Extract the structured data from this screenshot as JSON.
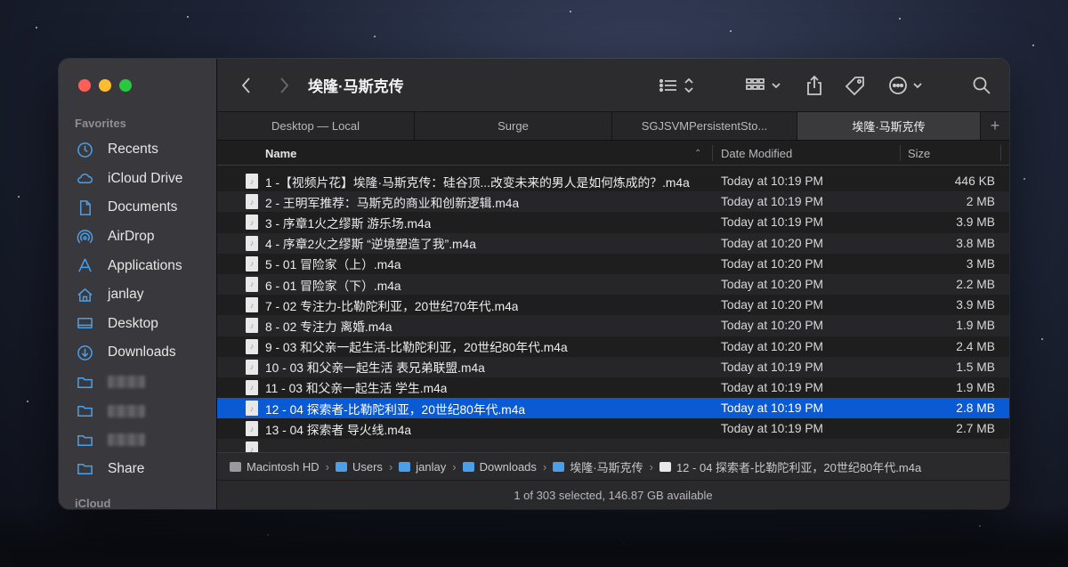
{
  "window": {
    "title": "埃隆·马斯克传"
  },
  "sidebar": {
    "favorites_label": "Favorites",
    "icloud_label": "iCloud",
    "items": [
      {
        "label": "Recents",
        "icon": "clock-icon"
      },
      {
        "label": "iCloud Drive",
        "icon": "cloud-icon"
      },
      {
        "label": "Documents",
        "icon": "document-icon"
      },
      {
        "label": "AirDrop",
        "icon": "airdrop-icon"
      },
      {
        "label": "Applications",
        "icon": "applications-icon"
      },
      {
        "label": "janlay",
        "icon": "home-icon"
      },
      {
        "label": "Desktop",
        "icon": "desktop-icon"
      },
      {
        "label": "Downloads",
        "icon": "download-icon"
      },
      {
        "label": "",
        "icon": "folder-icon"
      },
      {
        "label": "",
        "icon": "folder-icon"
      },
      {
        "label": "",
        "icon": "folder-icon"
      },
      {
        "label": "Share",
        "icon": "folder-icon"
      }
    ]
  },
  "tabs": [
    {
      "label": "Desktop — Local"
    },
    {
      "label": "Surge"
    },
    {
      "label": "SGJSVMPersistentSto..."
    },
    {
      "label": "埃隆·马斯克传"
    }
  ],
  "columns": {
    "name": "Name",
    "date": "Date Modified",
    "size": "Size"
  },
  "files": [
    {
      "name": "1 -【视频片花】埃隆·马斯克传：硅谷顶...改变未来的男人是如何炼成的？.m4a",
      "date": "Today at 10:19 PM",
      "size": "446 KB"
    },
    {
      "name": "2 - 王明军推荐：马斯克的商业和创新逻辑.m4a",
      "date": "Today at 10:19 PM",
      "size": "2 MB"
    },
    {
      "name": "3 - 序章1火之缪斯 游乐场.m4a",
      "date": "Today at 10:19 PM",
      "size": "3.9 MB"
    },
    {
      "name": "4 - 序章2火之缪斯 “逆境塑造了我”.m4a",
      "date": "Today at 10:20 PM",
      "size": "3.8 MB"
    },
    {
      "name": "5 - 01 冒险家（上）.m4a",
      "date": "Today at 10:20 PM",
      "size": "3 MB"
    },
    {
      "name": "6 - 01 冒险家（下）.m4a",
      "date": "Today at 10:20 PM",
      "size": "2.2 MB"
    },
    {
      "name": "7 - 02 专注力-比勒陀利亚，20世纪70年代.m4a",
      "date": "Today at 10:20 PM",
      "size": "3.9 MB"
    },
    {
      "name": "8 - 02 专注力 离婚.m4a",
      "date": "Today at 10:20 PM",
      "size": "1.9 MB"
    },
    {
      "name": "9 - 03 和父亲一起生活-比勒陀利亚，20世纪80年代.m4a",
      "date": "Today at 10:20 PM",
      "size": "2.4 MB"
    },
    {
      "name": "10 - 03 和父亲一起生活 表兄弟联盟.m4a",
      "date": "Today at 10:19 PM",
      "size": "1.5 MB"
    },
    {
      "name": "11 - 03 和父亲一起生活 学生.m4a",
      "date": "Today at 10:19 PM",
      "size": "1.9 MB"
    },
    {
      "name": "12 - 04 探索者-比勒陀利亚，20世纪80年代.m4a",
      "date": "Today at 10:19 PM",
      "size": "2.8 MB",
      "selected": true
    },
    {
      "name": "13 - 04 探索者 导火线.m4a",
      "date": "Today at 10:19 PM",
      "size": "2.7 MB"
    },
    {
      "name": "",
      "date": "",
      "size": ""
    }
  ],
  "pathbar": [
    {
      "label": "Macintosh HD",
      "color": "#9a9a9e"
    },
    {
      "label": "Users",
      "color": "#4a9fe8"
    },
    {
      "label": "janlay",
      "color": "#4a9fe8"
    },
    {
      "label": "Downloads",
      "color": "#4a9fe8"
    },
    {
      "label": "埃隆·马斯克传",
      "color": "#4a9fe8"
    },
    {
      "label": "12 - 04 探索者-比勒陀利亚，20世纪80年代.m4a",
      "color": "#e8e8e8"
    }
  ],
  "status": "1 of 303 selected, 146.87 GB available",
  "colors": {
    "selection": "#0a5ad4",
    "accent": "#4a9fe8"
  }
}
